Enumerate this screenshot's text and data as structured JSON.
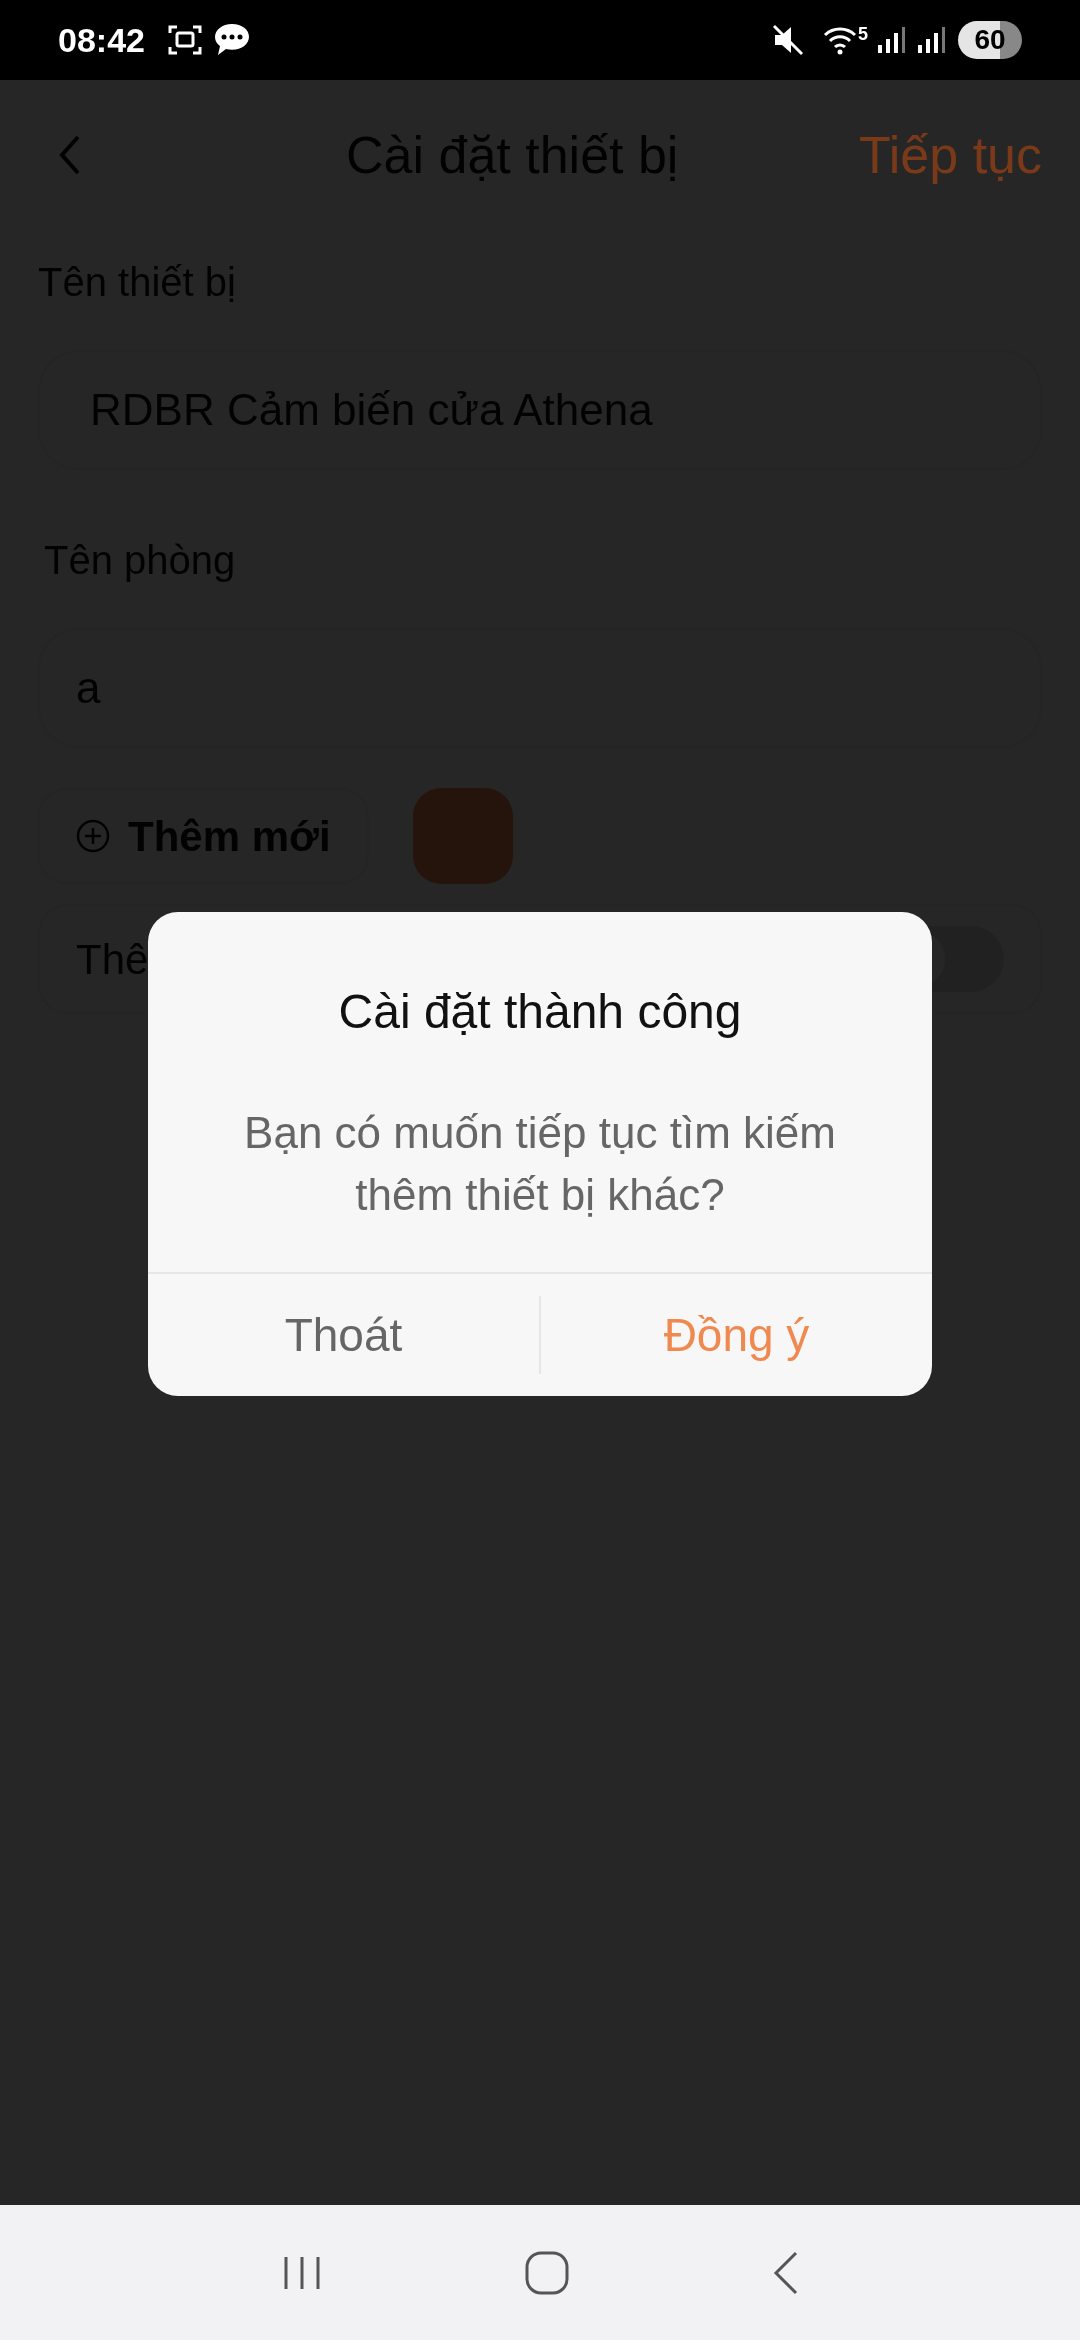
{
  "status_bar": {
    "time": "08:42",
    "battery": "60",
    "network_badge": "5"
  },
  "header": {
    "title": "Cài đặt thiết bị",
    "action": "Tiếp tục"
  },
  "device_name": {
    "label": "Tên thiết bị",
    "value": "RDBR Cảm biến cửa Athena"
  },
  "room_name": {
    "label": "Tên phòng",
    "value": "a"
  },
  "add_button": {
    "label": "Thêm mới"
  },
  "partial_row": {
    "label": "Thê",
    "toggle_on": false
  },
  "dialog": {
    "title": "Cài đặt thành công",
    "message": "Bạn có muốn tiếp tục tìm kiếm thêm thiết bị khác?",
    "buttons": [
      {
        "label": "Thoát",
        "kind": "cancel"
      },
      {
        "label": "Đồng ý",
        "kind": "confirm"
      }
    ]
  }
}
